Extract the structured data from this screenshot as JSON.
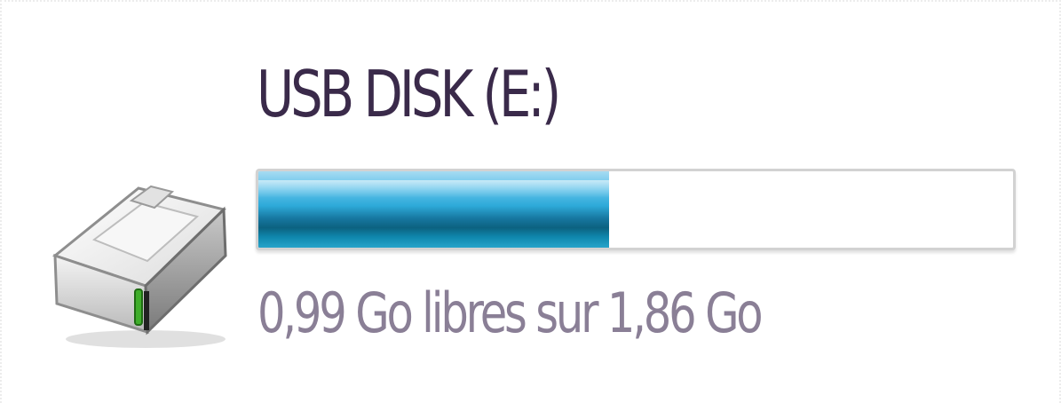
{
  "drive": {
    "name": "USB DISK (E:)",
    "space_text": "0,99 Go libres sur 1,86 Go",
    "used_fraction": 0.465,
    "icon": "usb-drive-icon",
    "bar_color": "#1e9ccb"
  }
}
